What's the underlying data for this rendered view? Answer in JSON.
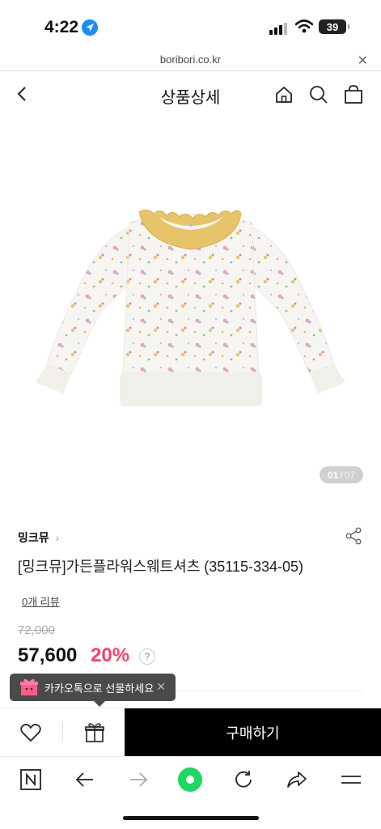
{
  "status_bar": {
    "time": "4:22",
    "battery": "39"
  },
  "browser_url": {
    "domain": "boribori.co.kr"
  },
  "header": {
    "title": "상품상세"
  },
  "gallery": {
    "current": "01",
    "separator": "/",
    "total": "07"
  },
  "product": {
    "brand": "밍크뮤",
    "name": "[밍크뮤]가든플라워스웨트셔츠 (35115-334-05)",
    "review_link": "0개 리뷰",
    "original_price": "72,000",
    "sale_price": "57,600",
    "discount": "20%",
    "help": "?"
  },
  "tooltip": {
    "text": "카카오톡으로 선물하세요"
  },
  "actions": {
    "buy_label": "구매하기"
  },
  "colors": {
    "accent_discount": "#ff3f6c",
    "buy_button": "#000000",
    "location_blue": "#1a8cff",
    "browser_green": "#1ed760"
  },
  "icons": [
    "location-arrow-icon",
    "signal-icon",
    "wifi-icon",
    "back-icon",
    "home-icon",
    "search-icon",
    "bag-icon",
    "share-icon",
    "heart-icon",
    "gift-icon",
    "n-logo-icon",
    "arrow-left-icon",
    "arrow-right-icon",
    "refresh-icon",
    "share-arrow-icon",
    "menu-icon"
  ]
}
